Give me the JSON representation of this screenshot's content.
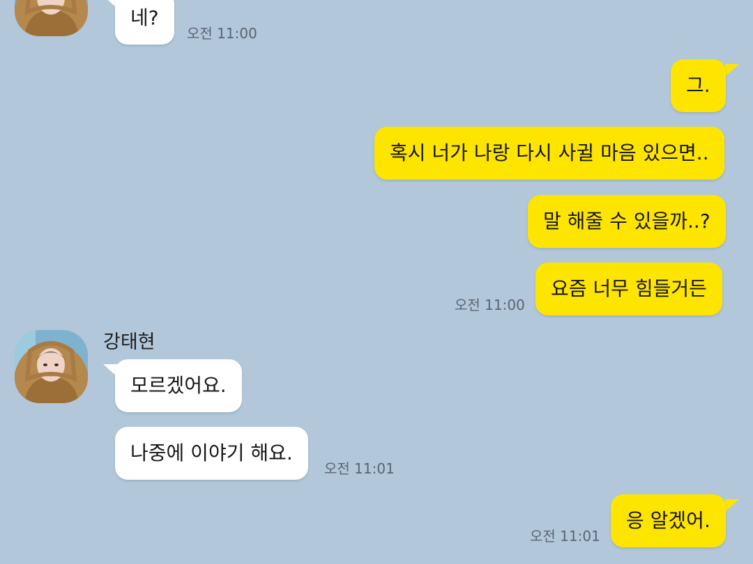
{
  "contact": {
    "name": "강태현"
  },
  "messages": [
    {
      "side": "received",
      "text": "네?",
      "time": "오전 11:00"
    },
    {
      "side": "sent",
      "text": "그."
    },
    {
      "side": "sent",
      "text": "혹시 너가 나랑 다시 사귈 마음 있으면.."
    },
    {
      "side": "sent",
      "text": "말 해줄 수 있을까..?"
    },
    {
      "side": "sent",
      "text": "요즘 너무 힘들거든",
      "time": "오전 11:00"
    },
    {
      "side": "received",
      "text": "모르겠어요."
    },
    {
      "side": "received",
      "text": "나중에 이야기 해요.",
      "time": "오전 11:01"
    },
    {
      "side": "sent",
      "text": "응 알겠어.",
      "time": "오전 11:01"
    }
  ],
  "colors": {
    "background": "#b2c7da",
    "sent_bubble": "#fee500",
    "received_bubble": "#ffffff"
  }
}
